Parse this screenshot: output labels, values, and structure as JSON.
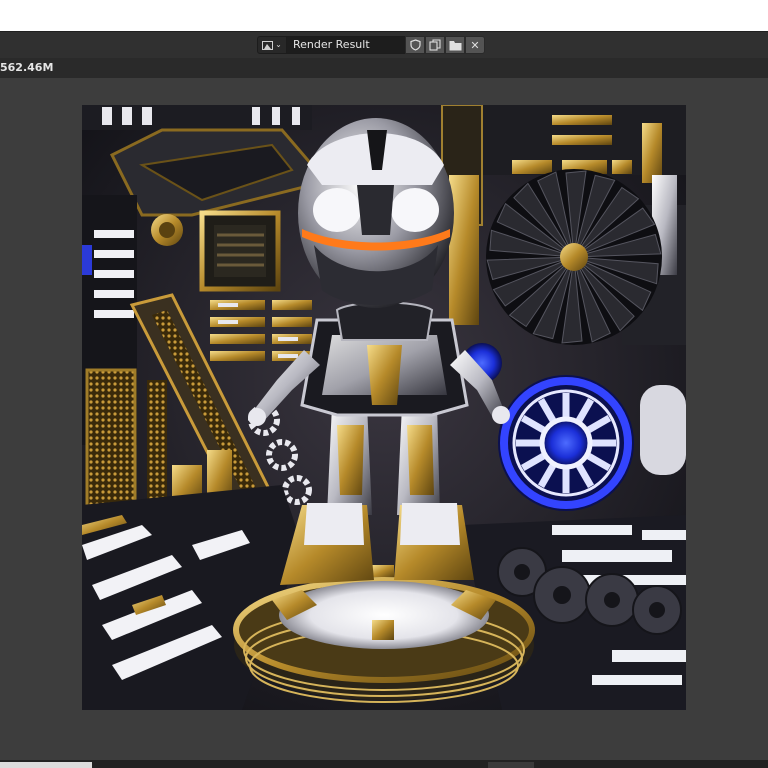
{
  "image_editor": {
    "image_name": "Render Result",
    "icons": {
      "image_type": "image-icon",
      "fake_user": "shield-icon",
      "duplicate": "duplicate-icon",
      "open": "folder-icon",
      "unlink": "close-icon"
    },
    "unlink_glyph": "✕"
  },
  "info": {
    "memory": "562.46M"
  },
  "colors": {
    "header_bg": "#303030",
    "canvas_bg": "#3d3d3d",
    "field_bg": "#1d1d1d"
  }
}
